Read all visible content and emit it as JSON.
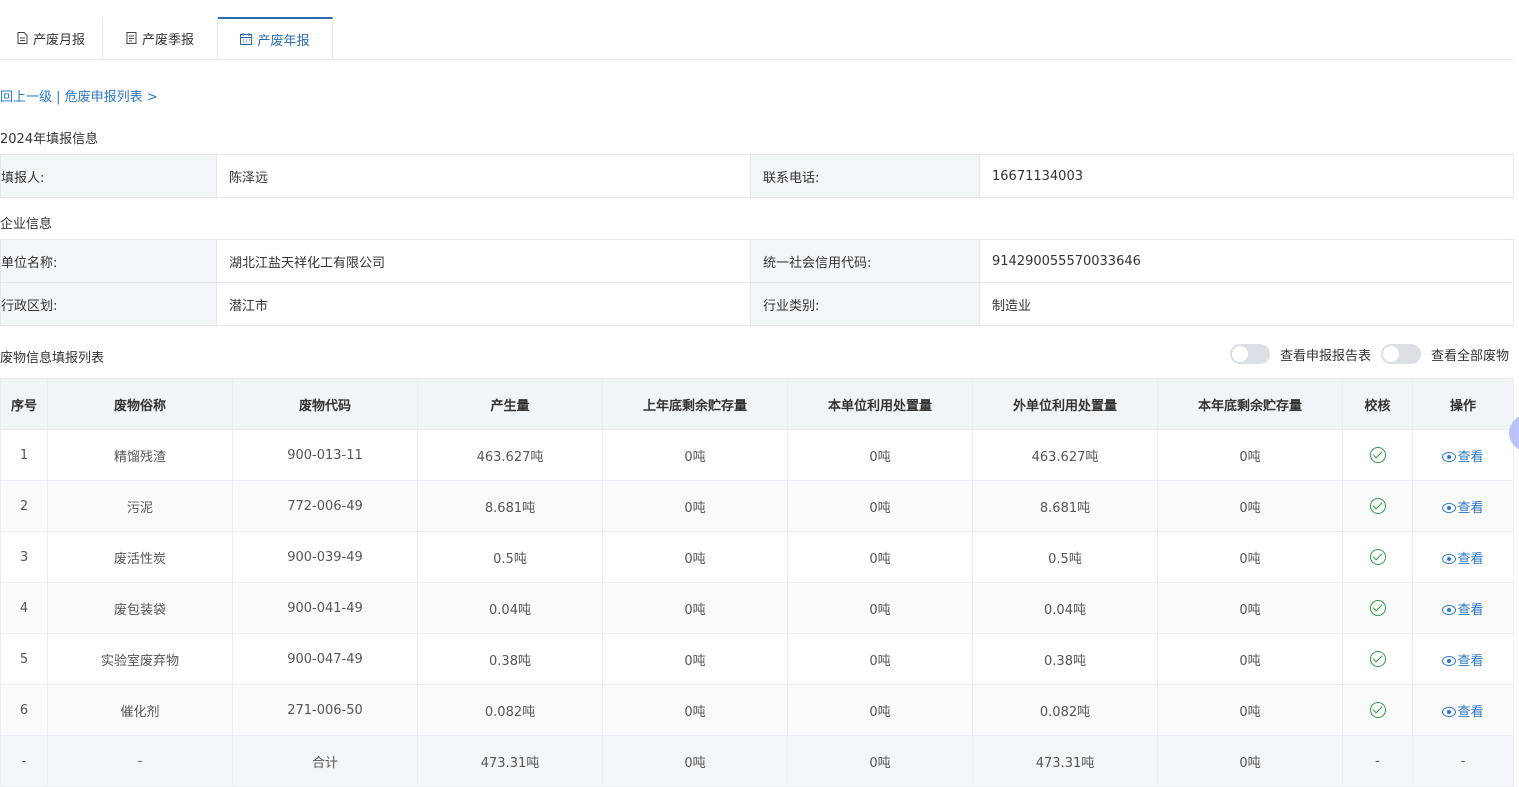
{
  "tabs": [
    {
      "label": "产废月报",
      "icon": "document-icon"
    },
    {
      "label": "产废季报",
      "icon": "list-document-icon"
    },
    {
      "label": "产废年报",
      "icon": "calendar-icon",
      "active": true
    }
  ],
  "breadcrumb": {
    "back": "回上一级",
    "separator": " | ",
    "current": "危废申报列表 >"
  },
  "filing": {
    "title": "2024年填报信息",
    "reporter_label": "填报人:",
    "reporter": "陈泽远",
    "phone_label": "联系电话:",
    "phone": "16671134003"
  },
  "company": {
    "title": "企业信息",
    "name_label": "单位名称:",
    "name": "湖北江盐天祥化工有限公司",
    "credit_label": "统一社会信用代码:",
    "credit": "91429005557003364​6",
    "district_label": "行政区划:",
    "district": "潜江市",
    "industry_label": "行业类别:",
    "industry": "制造业"
  },
  "waste_list": {
    "title": "废物信息填报列表",
    "toggle1_label": "查看申报报告表",
    "toggle2_label": "查看全部废物",
    "columns": [
      "序号",
      "废物俗称",
      "废物代码",
      "产生量",
      "上年底剩余贮存量",
      "本单位利用处置量",
      "外单位利用处置量",
      "本年底剩余贮存量",
      "校核",
      "操作"
    ],
    "view_label": "查看",
    "rows": [
      {
        "no": "1",
        "name": "精馏残渣",
        "code": "900-013-11",
        "produced": "463.627吨",
        "prev_stock": "0吨",
        "self_dispose": "0吨",
        "ext_dispose": "463.627吨",
        "year_stock": "0吨"
      },
      {
        "no": "2",
        "name": "污泥",
        "code": "772-006-49",
        "produced": "8.681吨",
        "prev_stock": "0吨",
        "self_dispose": "0吨",
        "ext_dispose": "8.681吨",
        "year_stock": "0吨"
      },
      {
        "no": "3",
        "name": "废活性炭",
        "code": "900-039-49",
        "produced": "0.5吨",
        "prev_stock": "0吨",
        "self_dispose": "0吨",
        "ext_dispose": "0.5吨",
        "year_stock": "0吨"
      },
      {
        "no": "4",
        "name": "废包装袋",
        "code": "900-041-49",
        "produced": "0.04吨",
        "prev_stock": "0吨",
        "self_dispose": "0吨",
        "ext_dispose": "0.04吨",
        "year_stock": "0吨"
      },
      {
        "no": "5",
        "name": "实验室废弃物",
        "code": "900-047-49",
        "produced": "0.38吨",
        "prev_stock": "0吨",
        "self_dispose": "0吨",
        "ext_dispose": "0.38吨",
        "year_stock": "0吨"
      },
      {
        "no": "6",
        "name": "催化剂",
        "code": "271-006-50",
        "produced": "0.082吨",
        "prev_stock": "0吨",
        "self_dispose": "0吨",
        "ext_dispose": "0.082吨",
        "year_stock": "0吨"
      }
    ],
    "total": {
      "no": "-",
      "name": "-",
      "code": "合计",
      "produced": "473.31吨",
      "prev_stock": "0吨",
      "self_dispose": "0吨",
      "ext_dispose": "473.31吨",
      "year_stock": "0吨",
      "check": "-",
      "action": "-"
    }
  },
  "colors": {
    "accent": "#2b78c8",
    "check": "#2e9b45",
    "label_bg": "#f3f6f9"
  }
}
